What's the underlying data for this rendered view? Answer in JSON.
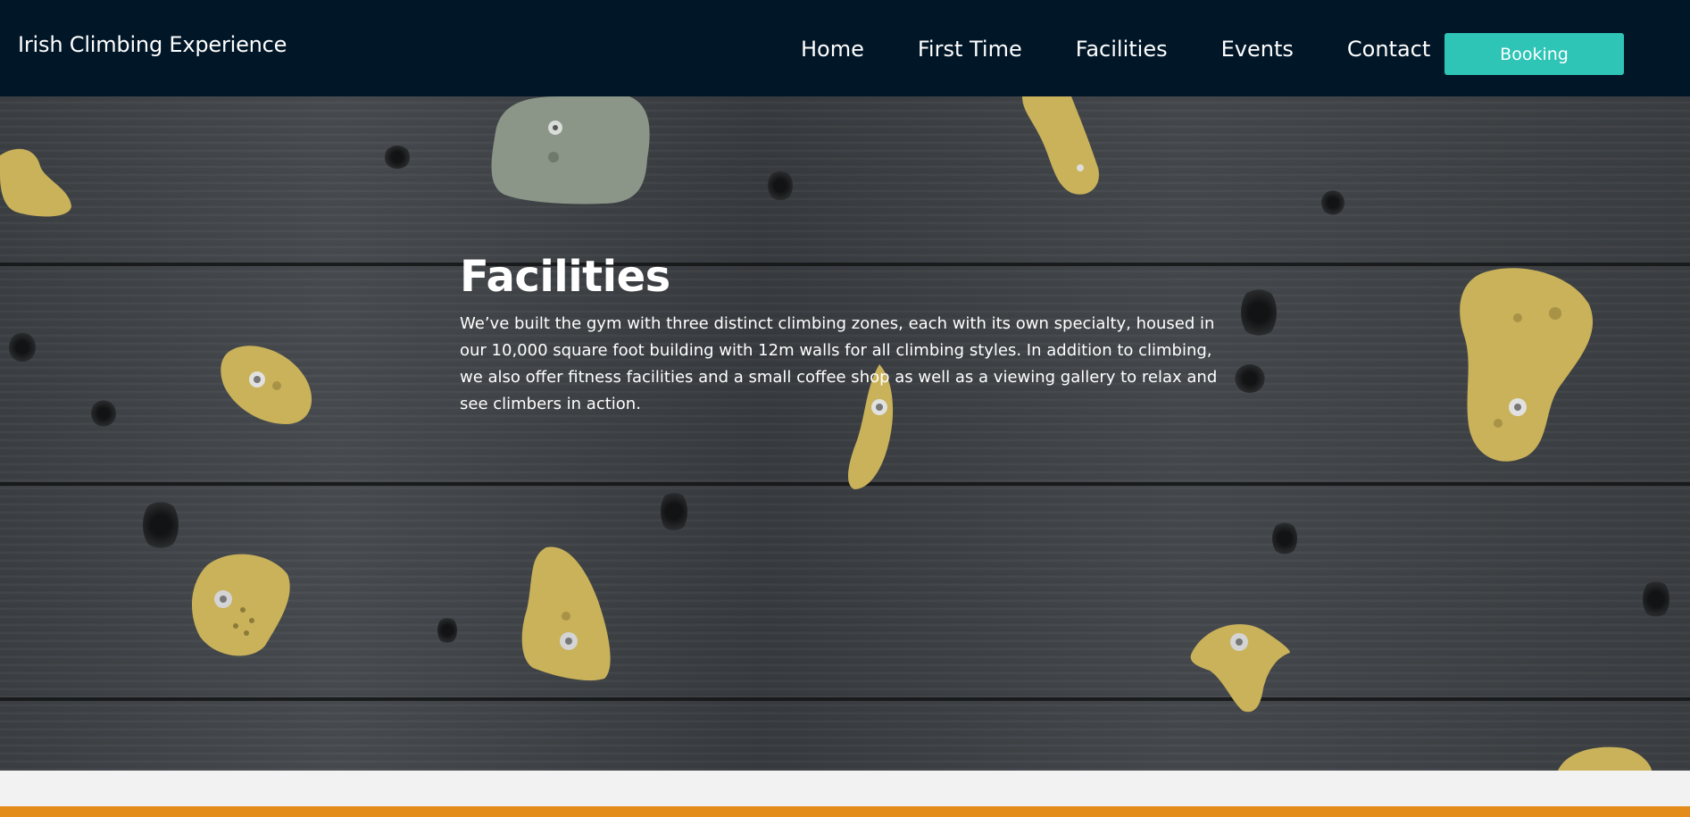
{
  "header": {
    "brand": "Irish Climbing Experience",
    "nav": [
      "Home",
      "First Time",
      "Facilities",
      "Events",
      "Contact"
    ],
    "booking_label": "Booking"
  },
  "hero": {
    "title": "Facilities",
    "description": "We’ve built the gym with three distinct climbing zones, each with its own specialty, housed in our 10,000 square foot building with 12m walls for all climbing styles. In addition to climbing, we also offer fitness facilities and a small coffee shop as well as a viewing gallery to relax and see climbers in action."
  },
  "colors": {
    "navbar": "#011627",
    "accent": "#2ec4b6",
    "footer_stripe": "#e38b1b",
    "hold_yellow": "#c9b25a",
    "hold_green": "#8b9688"
  },
  "icons": {
    "background": "climbing-wall-image"
  }
}
